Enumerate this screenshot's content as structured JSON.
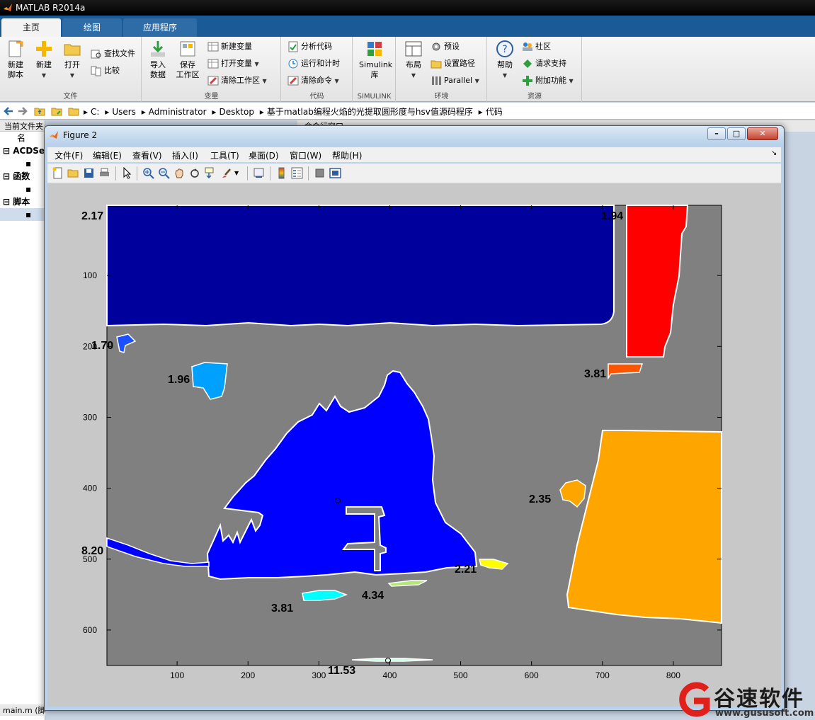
{
  "app": {
    "title": "MATLAB R2014a"
  },
  "tabs": [
    {
      "label": "主页",
      "active": true
    },
    {
      "label": "绘图",
      "active": false
    },
    {
      "label": "应用程序",
      "active": false
    }
  ],
  "ribbon": {
    "groups": [
      {
        "label": "文件"
      },
      {
        "label": "变量"
      },
      {
        "label": "代码"
      },
      {
        "label": "SIMULINK"
      },
      {
        "label": "环境"
      },
      {
        "label": "资源"
      }
    ],
    "new_script": [
      "新建",
      "脚本"
    ],
    "new": "新建",
    "open": "打开",
    "find_files": "查找文件",
    "compare": "比较",
    "import": [
      "导入",
      "数据"
    ],
    "save_ws": [
      "保存",
      "工作区"
    ],
    "new_var": "新建变量",
    "open_var": "打开变量",
    "clear_ws": "清除工作区",
    "analyze": "分析代码",
    "run_time": "运行和计时",
    "clear_cmd": "清除命令",
    "simulink": [
      "Simulink",
      "库"
    ],
    "layout": "布局",
    "prefs": "预设",
    "set_path": "设置路径",
    "parallel": "Parallel",
    "help": "帮助",
    "community": "社区",
    "support": "请求支持",
    "addons": "附加功能"
  },
  "address": {
    "crumbs": [
      "C:",
      "Users",
      "Administrator",
      "Desktop",
      "基于matlab编程火焰的光提取圆形度与hsv值源码程序",
      "代码"
    ]
  },
  "left_panel": {
    "header": "当前文件夹",
    "col_header": "名",
    "items": [
      {
        "label": "ACDSe",
        "bold": true
      },
      {
        "label": "函数",
        "bold": true
      },
      {
        "label": "脚本",
        "bold": true
      }
    ],
    "footer": "main.m (脚本)"
  },
  "cmd_header": "命令行窗口",
  "figure": {
    "title": "Figure 2",
    "menu": [
      "文件(F)",
      "编辑(E)",
      "查看(V)",
      "插入(I)",
      "工具(T)",
      "桌面(D)",
      "窗口(W)",
      "帮助(H)"
    ],
    "toolbar": [
      "new-icon",
      "open-icon",
      "save-icon",
      "print-icon",
      "pointer-icon",
      "zoom-in-icon",
      "zoom-out-icon",
      "pan-icon",
      "rotate-icon",
      "data-cursor-icon",
      "brush-icon",
      "link-icon",
      "colorbar-icon",
      "legend-icon",
      "hide-plot-tools-icon",
      "show-plot-tools-icon"
    ],
    "x_ticks": [
      100,
      200,
      300,
      400,
      500,
      600,
      700,
      800
    ],
    "y_ticks": [
      100,
      200,
      300,
      400,
      500,
      600
    ],
    "x_range": [
      1,
      868
    ],
    "y_range": [
      1,
      650
    ],
    "labels": [
      "2.17",
      "1.94",
      "1.70",
      "1.96",
      "3.81",
      "2.35",
      "8.20",
      "2.21",
      "4.34",
      "3.81",
      "11.53"
    ],
    "colors": {
      "background": "#808080",
      "dark_blue": "#00009c",
      "red": "#ff0000",
      "blue": "#0000ff",
      "orange": "#ffa500",
      "cyan": "#00ffff",
      "yellow": "#ffff00",
      "light_blue": "#00a0ff",
      "orange_red": "#ff5500"
    }
  },
  "watermark": {
    "name": "谷速软件",
    "url": "www.gususoft.com"
  }
}
